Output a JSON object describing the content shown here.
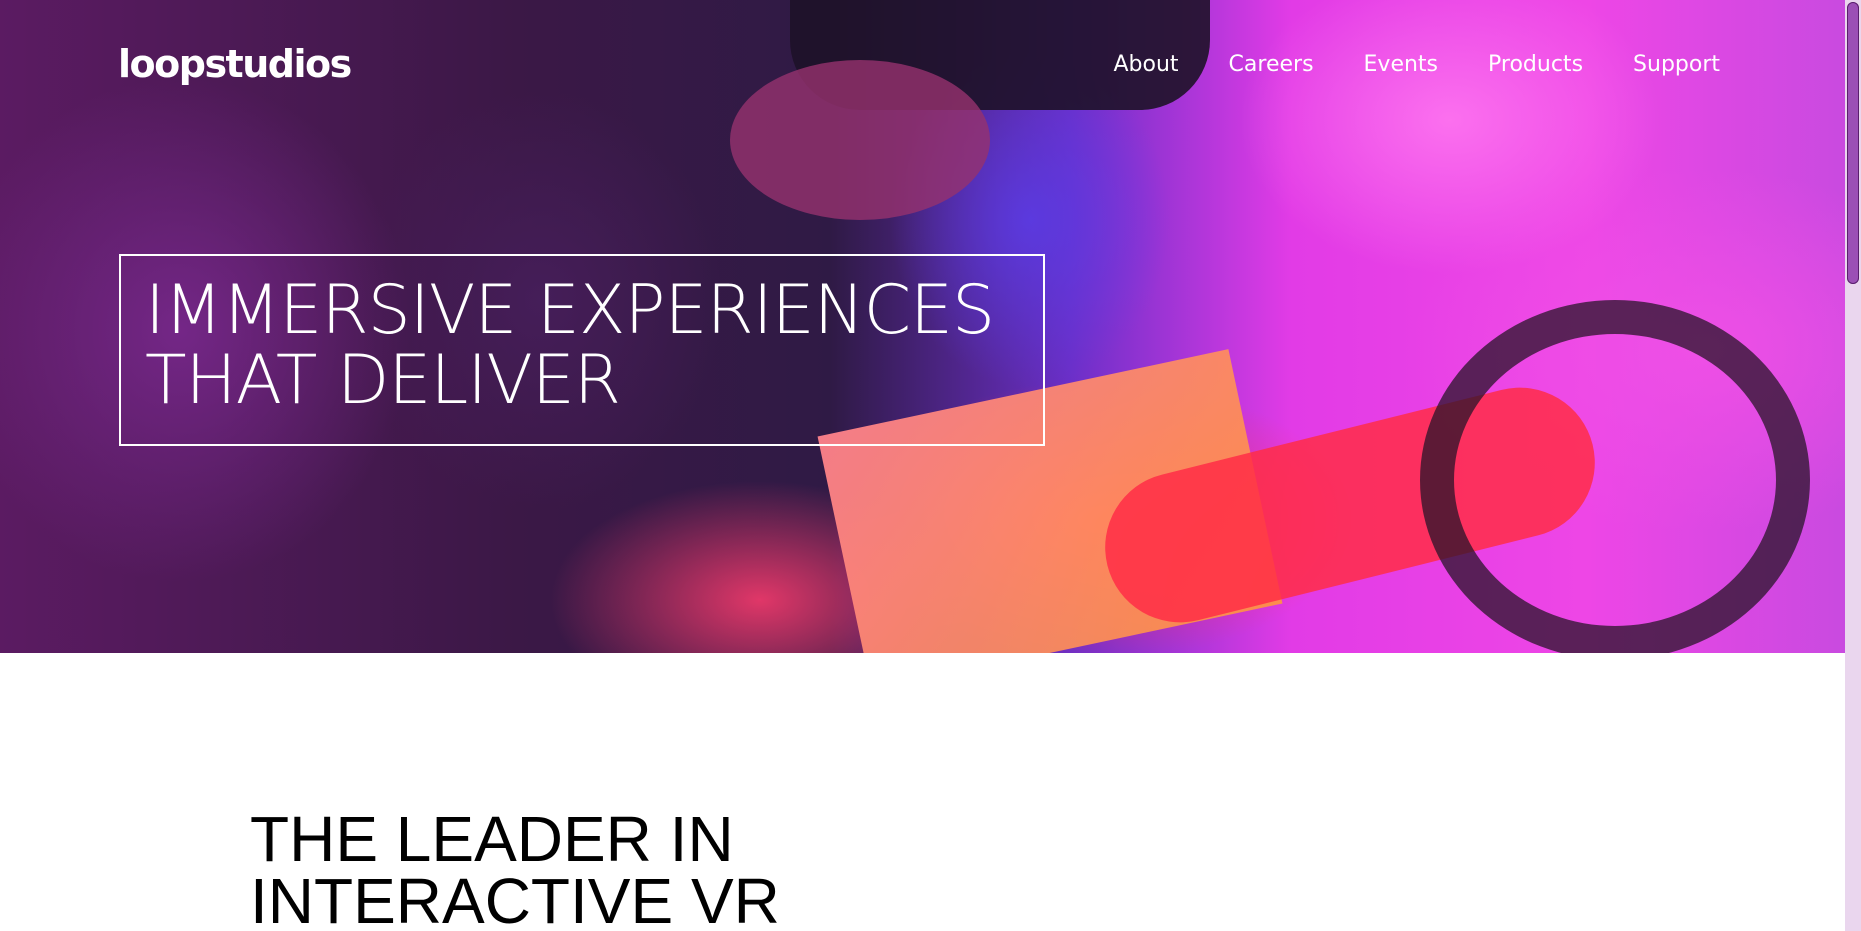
{
  "header": {
    "logo": "loopstudios",
    "nav": [
      "About",
      "Careers",
      "Events",
      "Products",
      "Support"
    ]
  },
  "hero": {
    "title_line1": "IMMERSIVE EXPERIENCES",
    "title_line2": "THAT DELIVER"
  },
  "intro": {
    "title_line1": "THE LEADER IN",
    "title_line2": "INTERACTIVE VR"
  },
  "colors": {
    "hero_magenta": "#ee46e6",
    "hero_purple": "#6b2fc8",
    "hero_red": "#ff3259",
    "text_light": "#ffffff",
    "text_dark": "#000000",
    "scrollbar_track": "#ead6ee",
    "scrollbar_thumb": "#9b4fb5"
  }
}
